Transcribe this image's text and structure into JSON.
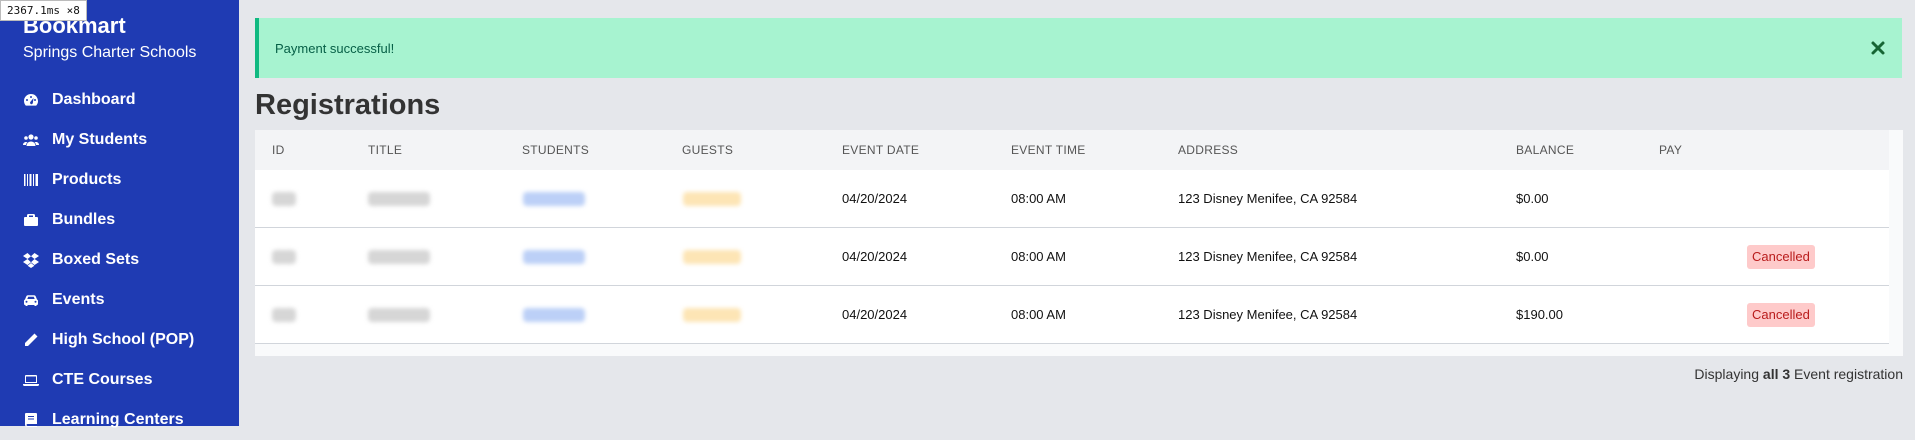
{
  "timer": "2367.1ms ×8",
  "sidebar": {
    "brand_title": "Bookmart",
    "brand_subtitle": "Springs Charter Schools",
    "items": [
      {
        "label": "Dashboard",
        "icon": "dashboard-icon"
      },
      {
        "label": "My Students",
        "icon": "users-icon"
      },
      {
        "label": "Products",
        "icon": "barcode-icon"
      },
      {
        "label": "Bundles",
        "icon": "briefcase-icon"
      },
      {
        "label": "Boxed Sets",
        "icon": "dropbox-icon"
      },
      {
        "label": "Events",
        "icon": "car-icon"
      },
      {
        "label": "High School (POP)",
        "icon": "pencil-icon"
      },
      {
        "label": "CTE Courses",
        "icon": "laptop-icon"
      },
      {
        "label": "Learning Centers",
        "icon": "book-icon"
      }
    ]
  },
  "alert": {
    "message": "Payment successful!",
    "close_icon": "close-icon"
  },
  "page": {
    "title": "Registrations"
  },
  "table": {
    "headers": [
      "ID",
      "TITLE",
      "STUDENTS",
      "GUESTS",
      "EVENT DATE",
      "EVENT TIME",
      "ADDRESS",
      "BALANCE",
      "PAY"
    ],
    "rows": [
      {
        "event_date": "04/20/2024",
        "event_time": "08:00 AM",
        "address": "123 Disney Menifee, CA 92584",
        "balance": "$0.00",
        "status": ""
      },
      {
        "event_date": "04/20/2024",
        "event_time": "08:00 AM",
        "address": "123 Disney Menifee, CA 92584",
        "balance": "$0.00",
        "status": "Cancelled"
      },
      {
        "event_date": "04/20/2024",
        "event_time": "08:00 AM",
        "address": "123 Disney Menifee, CA 92584",
        "balance": "$190.00",
        "status": "Cancelled"
      }
    ]
  },
  "footer": {
    "prefix": "Displaying",
    "count": "all 3",
    "suffix": "Event registration"
  },
  "colors": {
    "sidebar": "#1f3bb3",
    "alert_bg": "#a7f3d0",
    "alert_text": "#065f46",
    "badge_bg": "#fecaca",
    "badge_text": "#b91c1c"
  }
}
